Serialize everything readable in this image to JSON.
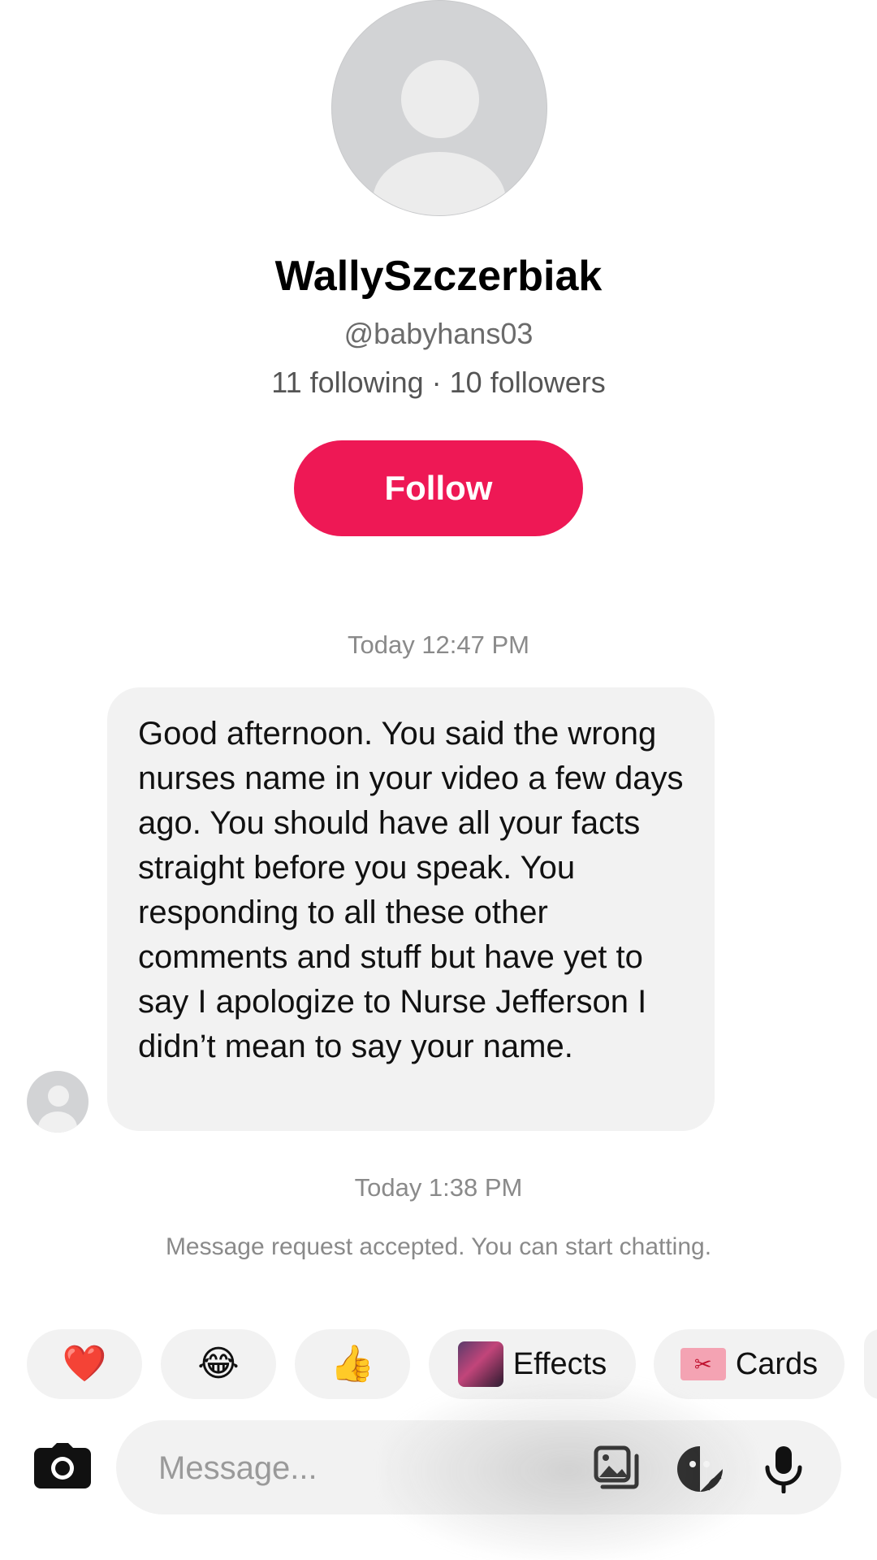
{
  "profile": {
    "display_name": "WallySzczerbiak",
    "username": "@babyhans03",
    "stats": "11 following · 10 followers",
    "follow_label": "Follow",
    "accent_color": "#ee1855"
  },
  "conversation": {
    "timestamp_1": "Today 12:47 PM",
    "message_1": "Good afternoon. You said the wrong nurses name in your video a few days ago. You should have all your facts straight before you speak. You responding to all these other comments and stuff but have yet to say I apologize to Nurse Jefferson I didn’t mean to say your name.",
    "timestamp_2": "Today 1:38 PM",
    "system_note": "Message request accepted. You can start chatting."
  },
  "quick_reactions": {
    "heart": "❤️",
    "laugh": "😂",
    "thumbs_up": "👍",
    "effects_label": "Effects",
    "cards_label": "Cards"
  },
  "composer": {
    "placeholder": "Message..."
  },
  "icons": [
    "profile-avatar-icon",
    "camera-icon",
    "gallery-icon",
    "sticker-icon",
    "microphone-icon",
    "effects-thumbnail-icon",
    "card-icon"
  ]
}
